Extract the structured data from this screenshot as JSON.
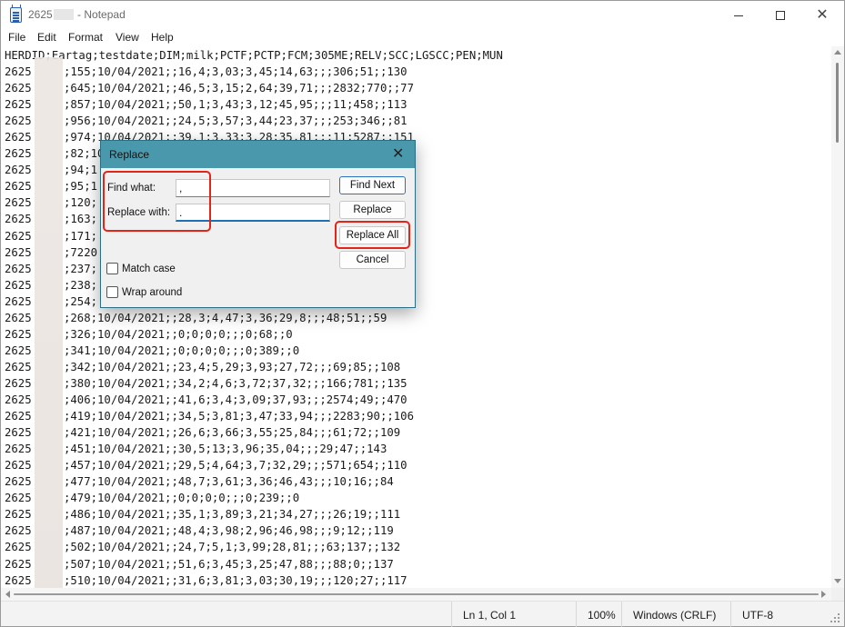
{
  "window": {
    "title_prefix": "2625",
    "title_suffix": " - Notepad"
  },
  "menu": [
    "File",
    "Edit",
    "Format",
    "View",
    "Help"
  ],
  "editor": {
    "header": "HERDID;Eartag;testdate;DIM;milk;PCTF;PCTP;FCM;305ME;RELV;SCC;LGSCC;PEN;MUN",
    "id_prefix": "2625",
    "rows": [
      ";155;10/04/2021;;16,4;3,03;3,45;14,63;;;306;51;;130",
      ";645;10/04/2021;;46,5;3,15;2,64;39,71;;;2832;770;;77",
      ";857;10/04/2021;;50,1;3,43;3,12;45,95;;;11;458;;113",
      ";956;10/04/2021;;24,5;3,57;3,44;23,37;;;253;346;;81",
      ";974;10/04/2021;;39,1;3,33;3,28;35,81;;;11;5287;;151",
      ";82;10/04/2021;;;;;;;;;;;;99",
      ";94;1",
      ";95;1                                         2",
      ";120;",
      ";163;                                         ;132",
      ";171;",
      ";7220                                         2",
      ";237;                                         ;;138",
      ";238;                                         91",
      ";254;                                         5",
      ";268;10/04/2021;;28,3;4,47;3,36;29,8;;;48;51;;59",
      ";326;10/04/2021;;0;0;0;0;;;0;68;;0",
      ";341;10/04/2021;;0;0;0;0;;;0;389;;0",
      ";342;10/04/2021;;23,4;5,29;3,93;27,72;;;69;85;;108",
      ";380;10/04/2021;;34,2;4,6;3,72;37,32;;;166;781;;135",
      ";406;10/04/2021;;41,6;3,4;3,09;37,93;;;2574;49;;470",
      ";419;10/04/2021;;34,5;3,81;3,47;33,94;;;2283;90;;106",
      ";421;10/04/2021;;26,6;3,66;3,55;25,84;;;61;72;;109",
      ";451;10/04/2021;;30,5;13;3,96;35,04;;;29;47;;143",
      ";457;10/04/2021;;29,5;4,64;3,7;32,29;;;571;654;;110",
      ";477;10/04/2021;;48,7;3,61;3,36;46,43;;;10;16;;84",
      ";479;10/04/2021;;0;0;0;0;;;0;239;;0",
      ";486;10/04/2021;;35,1;3,89;3,21;34,27;;;26;19;;111",
      ";487;10/04/2021;;48,4;3,98;2,96;46,98;;;9;12;;119",
      ";502;10/04/2021;;24,7;5,1;3,99;28,81;;;63;137;;132",
      ";507;10/04/2021;;51,6;3,45;3,25;47,88;;;88;0;;137",
      ";510;10/04/2021;;31,6;3,81;3,03;30,19;;;120;27;;117"
    ]
  },
  "dialog": {
    "title": "Replace",
    "find_label": "Find what:",
    "find_value": ",",
    "replace_label": "Replace with:",
    "replace_value": ".",
    "find_next": "Find Next",
    "replace": "Replace",
    "replace_all": "Replace All",
    "cancel": "Cancel",
    "match_case": "Match case",
    "wrap_around": "Wrap around",
    "highlight_color": "#e0261b"
  },
  "status": {
    "position": "Ln 1, Col 1",
    "zoom": "100%",
    "line_ending": "Windows (CRLF)",
    "encoding": "UTF-8"
  }
}
